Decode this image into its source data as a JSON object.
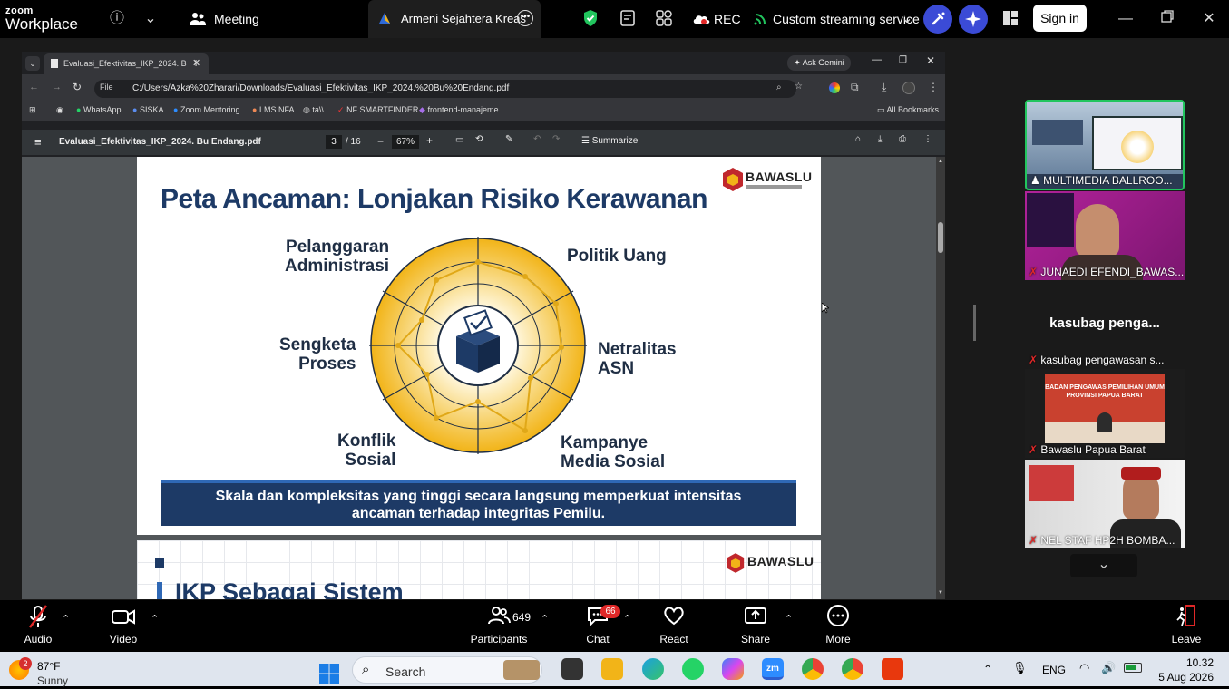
{
  "zoom": {
    "brand_top": "zoom",
    "brand_bottom": "Workplace",
    "meeting_label": "Meeting",
    "active_tab_title": "Armeni Sejahtera Kreas",
    "rec_label": "REC",
    "streaming_label": "Custom streaming service",
    "signin_label": "Sign in"
  },
  "browser": {
    "tab_title": "Evaluasi_Efektivitas_IKP_2024. B",
    "ask_gemini": "Ask Gemini",
    "address_chip": "File",
    "address": "C:/Users/Azka%20Zharari/Downloads/Evaluasi_Efektivitas_IKP_2024.%20Bu%20Endang.pdf",
    "bookmarks": [
      "WhatsApp",
      "SISKA",
      "Zoom Mentoring",
      "LMS NFA",
      "ta\\\\",
      "NF SMARTFINDER",
      "frontend-manajeme..."
    ],
    "all_bookmarks": "All Bookmarks"
  },
  "pdf": {
    "filename": "Evaluasi_Efektivitas_IKP_2024. Bu Endang.pdf",
    "page_current": "3",
    "page_total": "/ 16",
    "zoom": "67%",
    "summarize": "Summarize"
  },
  "slide": {
    "logo_text": "BAWASLU",
    "title": "Peta Ancaman: Lonjakan Risiko Kerawanan",
    "labels": {
      "top_left_1": "Pelanggaran",
      "top_left_2": "Administrasi",
      "top_right": "Politik Uang",
      "left_1": "Sengketa",
      "left_2": "Proses",
      "right_1": "Netralitas",
      "right_2": "ASN",
      "bottom_left_1": "Konflik",
      "bottom_left_2": "Sosial",
      "bottom_right_1": "Kampanye",
      "bottom_right_2": "Media Sosial"
    },
    "banner_line1": "Skala dan kompleksitas yang tinggi secara langsung memperkuat intensitas",
    "banner_line2": "ancaman terhadap integritas Pemilu.",
    "next_title": "IKP Sebagai Sistem",
    "next_logo": "BAWASLU"
  },
  "participants": {
    "tile1_name": "MULTIMEDIA BALLROO...",
    "tile2_name": "JUNAEDI EFENDI_BAWAS...",
    "heading": "kasubag penga...",
    "tile3_name": "kasubag pengawasan s...",
    "tile3_banner_1": "BADAN PENGAWAS PEMILIHAN UMUM",
    "tile3_banner_2": "PROVINSI PAPUA BARAT",
    "tile4_name": "Bawaslu Papua Barat",
    "tile5_name": "NEL STAF HP2H BOMBA..."
  },
  "controls": {
    "audio": "Audio",
    "video": "Video",
    "participants": "Participants",
    "participants_count": "649",
    "chat": "Chat",
    "chat_badge": "66",
    "react": "React",
    "share": "Share",
    "more": "More",
    "leave": "Leave"
  },
  "taskbar": {
    "weather_badge": "2",
    "temperature": "87°F",
    "condition": "Sunny",
    "search": "Search",
    "language": "ENG",
    "time": "10.32",
    "date": "5 Aug 2026"
  },
  "colors": {
    "slide_navy": "#1d3a66",
    "radar_gold": "#f2b418",
    "zoom_blue": "#3b4bd6",
    "leave_red": "#e02828"
  }
}
